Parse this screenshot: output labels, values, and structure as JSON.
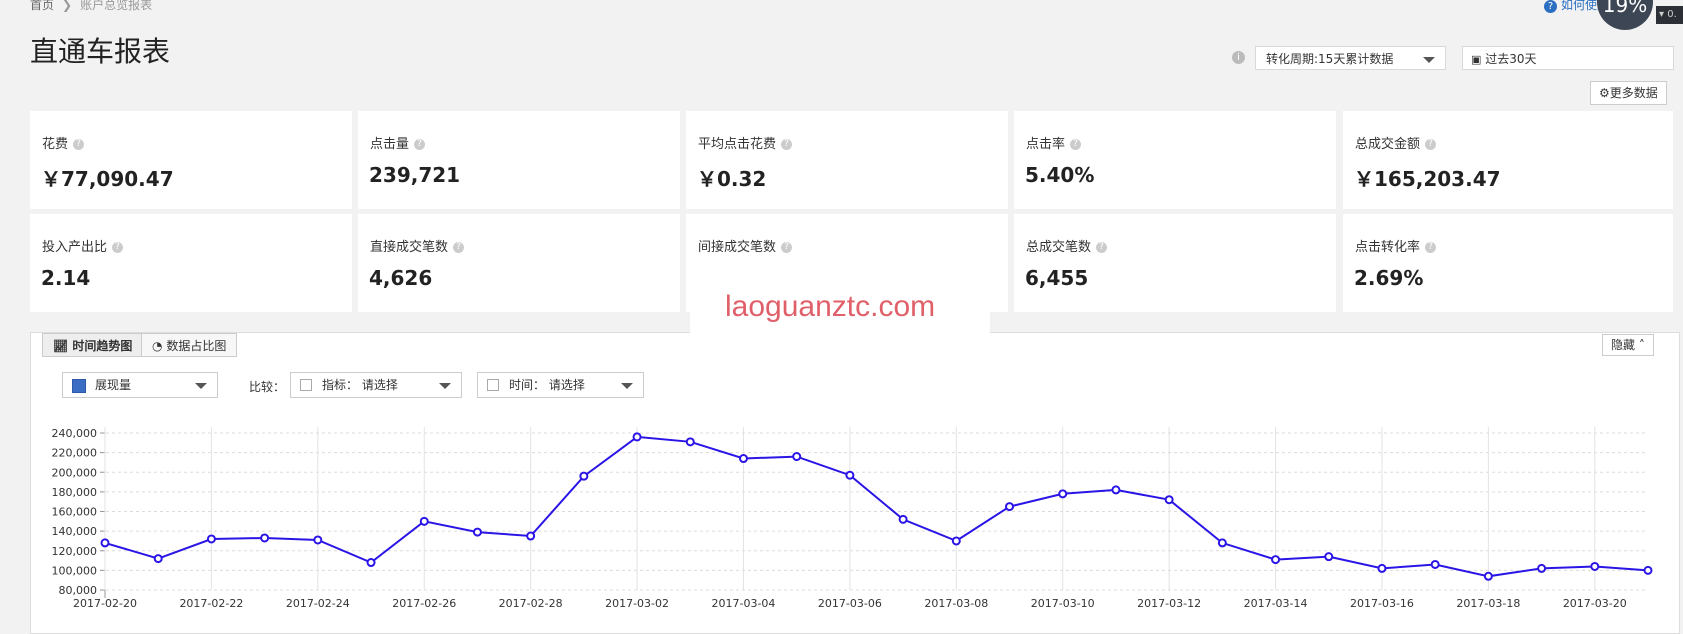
{
  "breadcrumb": {
    "home": "首页",
    "current": "账户总览报表"
  },
  "page_title": "直通车报表",
  "help_link": "如何使用",
  "float_badge": "19%",
  "corner_text": "0.",
  "controls": {
    "conversion_period": "转化周期:15天累计数据",
    "date_range": "过去30天",
    "more_data": "更多数据"
  },
  "metrics_row1": [
    {
      "label": "花费",
      "value": "￥77,090.47"
    },
    {
      "label": "点击量",
      "value": "239,721"
    },
    {
      "label": "平均点击花费",
      "value": "￥0.32"
    },
    {
      "label": "点击率",
      "value": "5.40%"
    },
    {
      "label": "总成交金额",
      "value": "￥165,203.47"
    }
  ],
  "metrics_row2": [
    {
      "label": "投入产出比",
      "value": "2.14"
    },
    {
      "label": "直接成交笔数",
      "value": "4,626"
    },
    {
      "label": "间接成交笔数",
      "value": ""
    },
    {
      "label": "总成交笔数",
      "value": "6,455"
    },
    {
      "label": "点击转化率",
      "value": "2.69%"
    }
  ],
  "watermark": "laoguanztc.com",
  "chart_panel": {
    "tabs": [
      "时间趋势图",
      "数据占比图"
    ],
    "hide_label": "隐藏",
    "metric_select": "展现量",
    "compare_label": "比较：",
    "compare_metric": "指标： 请选择",
    "compare_time": "时间： 请选择"
  },
  "colors": {
    "series": "#2a14e6",
    "accent": "#2b6fc2"
  },
  "chart_data": {
    "type": "line",
    "ylim": [
      80000,
      240000
    ],
    "y_ticks": [
      "80,000",
      "100,000",
      "120,000",
      "140,000",
      "160,000",
      "180,000",
      "200,000",
      "220,000",
      "240,000"
    ],
    "x_tick_labels": [
      "2017-02-20",
      "2017-02-22",
      "2017-02-24",
      "2017-02-26",
      "2017-02-28",
      "2017-03-02",
      "2017-03-04",
      "2017-03-06",
      "2017-03-08",
      "2017-03-10",
      "2017-03-12",
      "2017-03-14",
      "2017-03-16",
      "2017-03-18",
      "2017-03-20"
    ],
    "x": [
      "2017-02-20",
      "2017-02-21",
      "2017-02-22",
      "2017-02-23",
      "2017-02-24",
      "2017-02-25",
      "2017-02-26",
      "2017-02-27",
      "2017-02-28",
      "2017-03-01",
      "2017-03-02",
      "2017-03-03",
      "2017-03-04",
      "2017-03-05",
      "2017-03-06",
      "2017-03-07",
      "2017-03-08",
      "2017-03-09",
      "2017-03-10",
      "2017-03-11",
      "2017-03-12",
      "2017-03-13",
      "2017-03-14",
      "2017-03-15",
      "2017-03-16",
      "2017-03-17",
      "2017-03-18",
      "2017-03-19",
      "2017-03-20",
      "2017-03-21"
    ],
    "series": [
      {
        "values": [
          128000,
          112000,
          132000,
          133000,
          131000,
          108000,
          150000,
          139000,
          135000,
          196000,
          236000,
          231000,
          214000,
          216000,
          197000,
          152000,
          130000,
          165000,
          178000,
          182000,
          172000,
          128000,
          111000,
          114000,
          102000,
          106000,
          94000,
          102000,
          104000,
          100000
        ]
      }
    ]
  }
}
